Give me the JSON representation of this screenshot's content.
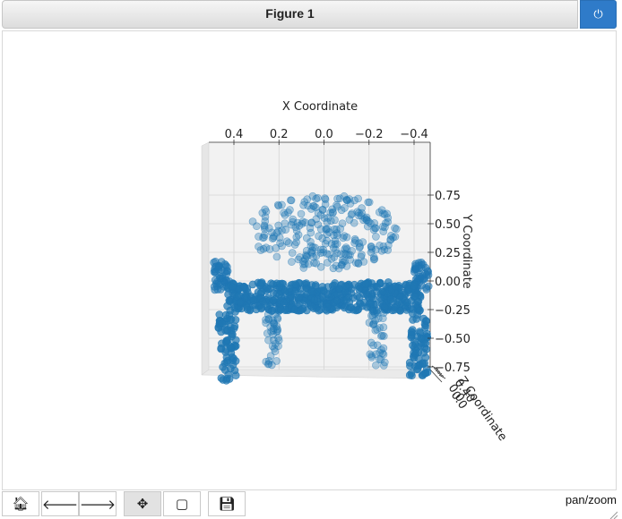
{
  "window": {
    "title": "Figure 1"
  },
  "toolbar": {
    "buttons": [
      {
        "icon": "home-icon",
        "glyph": "🏠︎"
      },
      {
        "icon": "back-arrow-icon",
        "glyph": "🡐"
      },
      {
        "icon": "forward-arrow-icon",
        "glyph": "🡒"
      },
      {
        "icon": "pan-move-icon",
        "glyph": "✥"
      },
      {
        "icon": "zoom-rect-icon",
        "glyph": "▢"
      },
      {
        "icon": "save-disk-icon",
        "glyph": "💾︎"
      }
    ],
    "status": "pan/zoom"
  },
  "chart_data": {
    "type": "scatter",
    "projection": "3d",
    "xlabel": "X Coordinate",
    "ylabel": "Y Coordinate",
    "zlabel": "Z Coordinate",
    "x_ticks": [
      "0.4",
      "0.2",
      "0.0",
      "−0.2",
      "−0.4"
    ],
    "y_ticks": [
      "0.75",
      "0.50",
      "0.25",
      "0.00",
      "−0.25",
      "−0.50",
      "−0.75"
    ],
    "z_ticks": [
      "0.40",
      "0.0",
      "0.0"
    ],
    "xlim": [
      0.5,
      -0.5
    ],
    "ylim": [
      -0.9,
      0.9
    ],
    "marker_color": "#1f77b4",
    "series": [
      {
        "parts": [
          {
            "part": "backrest",
            "shape": "ellipse",
            "x_center": 0.0,
            "y_center": 0.43,
            "x_radius": 0.33,
            "y_radius": 0.33,
            "count": 260,
            "density": "light"
          },
          {
            "part": "left-armrest",
            "shape": "rect",
            "x_range": [
              0.42,
              0.49
            ],
            "y_range": [
              -0.08,
              0.17
            ],
            "count": 45,
            "density": "medium"
          },
          {
            "part": "right-armrest",
            "shape": "rect",
            "x_range": [
              -0.47,
              -0.4
            ],
            "y_range": [
              -0.08,
              0.17
            ],
            "count": 45,
            "density": "medium"
          },
          {
            "part": "seat",
            "shape": "rect",
            "x_range": [
              -0.43,
              0.43
            ],
            "y_range": [
              -0.26,
              -0.01
            ],
            "count": 520,
            "density": "dense"
          },
          {
            "part": "left-front-leg",
            "shape": "rect",
            "x_range": [
              0.39,
              0.47
            ],
            "y_range": [
              -0.88,
              -0.26
            ],
            "count": 70,
            "density": "dense"
          },
          {
            "part": "right-front-leg",
            "shape": "rect",
            "x_range": [
              -0.46,
              -0.38
            ],
            "y_range": [
              -0.88,
              -0.26
            ],
            "count": 70,
            "density": "dense"
          },
          {
            "part": "left-back-leg",
            "shape": "rect",
            "x_range": [
              0.2,
              0.26
            ],
            "y_range": [
              -0.74,
              -0.26
            ],
            "count": 40,
            "density": "light"
          },
          {
            "part": "right-back-leg",
            "shape": "rect",
            "x_range": [
              -0.27,
              -0.2
            ],
            "y_range": [
              -0.74,
              -0.26
            ],
            "count": 40,
            "density": "light"
          }
        ]
      }
    ]
  }
}
